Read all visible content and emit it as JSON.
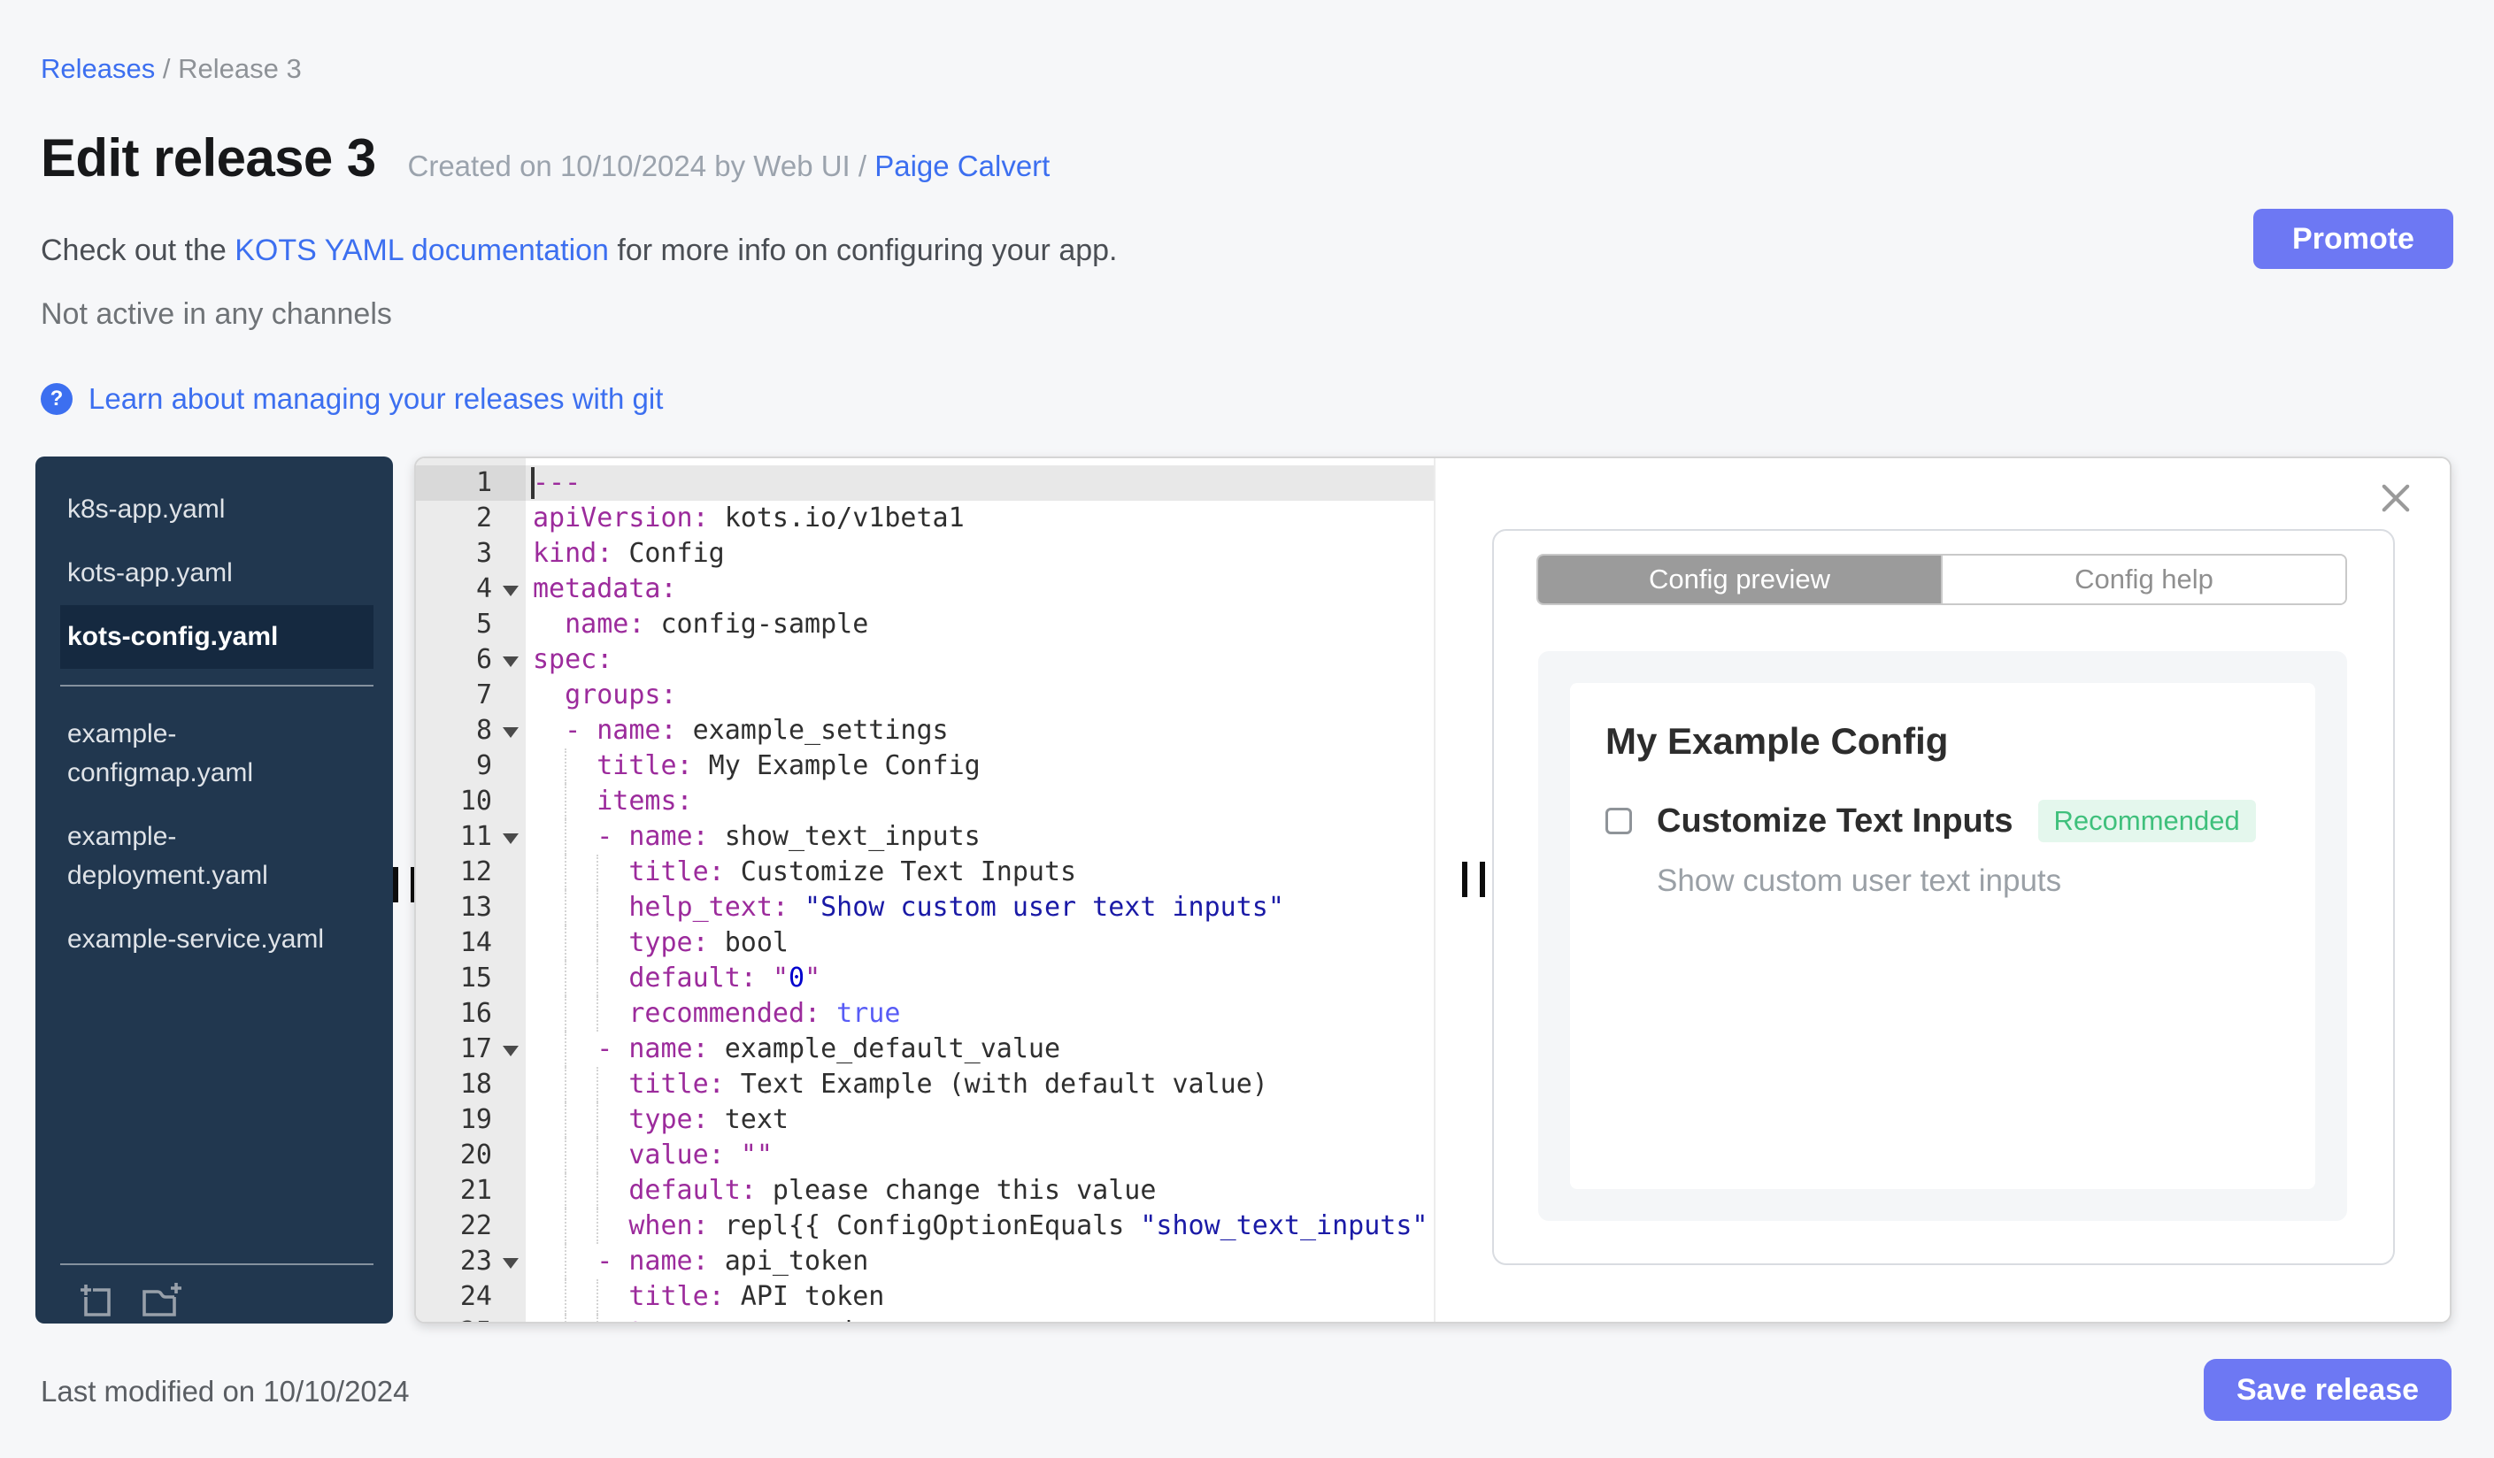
{
  "header": {
    "breadcrumb": {
      "link": "Releases",
      "separator": " / ",
      "current": "Release 3"
    },
    "title": "Edit release 3",
    "created_prefix": "Created on 10/10/2024 by Web UI / ",
    "created_author": "Paige Calvert",
    "docs_prefix": "Check out the ",
    "docs_link": "KOTS YAML documentation",
    "docs_suffix": " for more info on configuring your app.",
    "channel_status": "Not active in any channels",
    "git_help_link": "Learn about managing your releases with git",
    "promote_label": "Promote"
  },
  "sidebar": {
    "groups": [
      {
        "files": [
          {
            "name": "k8s-app.yaml",
            "selected": false
          },
          {
            "name": "kots-app.yaml",
            "selected": false
          },
          {
            "name": "kots-config.yaml",
            "selected": true
          }
        ]
      },
      {
        "files": [
          {
            "name": "example-configmap.yaml",
            "selected": false
          },
          {
            "name": "example-deployment.yaml",
            "selected": false
          },
          {
            "name": "example-service.yaml",
            "selected": false
          }
        ]
      }
    ],
    "icons": [
      "upload-file-icon",
      "new-file-icon"
    ]
  },
  "editor": {
    "active_line": 1,
    "fold_lines": [
      4,
      6,
      8,
      11,
      17,
      23
    ],
    "lines": [
      [
        {
          "t": "---",
          "c": "key"
        }
      ],
      [
        {
          "t": "apiVersion:",
          "c": "key"
        },
        {
          "t": " kots.io/v1beta1",
          "c": "txt"
        }
      ],
      [
        {
          "t": "kind:",
          "c": "key"
        },
        {
          "t": " Config",
          "c": "txt"
        }
      ],
      [
        {
          "t": "metadata:",
          "c": "key"
        }
      ],
      [
        {
          "t": "  name:",
          "c": "key"
        },
        {
          "t": " config-sample",
          "c": "txt"
        }
      ],
      [
        {
          "t": "spec:",
          "c": "key"
        }
      ],
      [
        {
          "t": "  groups:",
          "c": "key"
        }
      ],
      [
        {
          "t": "  - name:",
          "c": "key"
        },
        {
          "t": " example_settings",
          "c": "txt"
        }
      ],
      [
        {
          "t": "    title:",
          "c": "key"
        },
        {
          "t": " My Example Config",
          "c": "txt"
        }
      ],
      [
        {
          "t": "    items:",
          "c": "key"
        }
      ],
      [
        {
          "t": "    - name:",
          "c": "key"
        },
        {
          "t": " show_text_inputs",
          "c": "txt"
        }
      ],
      [
        {
          "t": "      title:",
          "c": "key"
        },
        {
          "t": " Customize Text Inputs",
          "c": "txt"
        }
      ],
      [
        {
          "t": "      help_text:",
          "c": "key"
        },
        {
          "t": " ",
          "c": "txt"
        },
        {
          "t": "\"Show custom user text inputs\"",
          "c": "str"
        }
      ],
      [
        {
          "t": "      type:",
          "c": "key"
        },
        {
          "t": " bool",
          "c": "txt"
        }
      ],
      [
        {
          "t": "      default:",
          "c": "key"
        },
        {
          "t": " ",
          "c": "txt"
        },
        {
          "t": "\"",
          "c": "key"
        },
        {
          "t": "0",
          "c": "num"
        },
        {
          "t": "\"",
          "c": "key"
        }
      ],
      [
        {
          "t": "      recommended:",
          "c": "key"
        },
        {
          "t": " ",
          "c": "txt"
        },
        {
          "t": "true",
          "c": "bool"
        }
      ],
      [
        {
          "t": "    - name:",
          "c": "key"
        },
        {
          "t": " example_default_value",
          "c": "txt"
        }
      ],
      [
        {
          "t": "      title:",
          "c": "key"
        },
        {
          "t": " Text Example (with default value)",
          "c": "txt"
        }
      ],
      [
        {
          "t": "      type:",
          "c": "key"
        },
        {
          "t": " text",
          "c": "txt"
        }
      ],
      [
        {
          "t": "      value:",
          "c": "key"
        },
        {
          "t": " ",
          "c": "txt"
        },
        {
          "t": "\"\"",
          "c": "key"
        }
      ],
      [
        {
          "t": "      default:",
          "c": "key"
        },
        {
          "t": " please change this value",
          "c": "txt"
        }
      ],
      [
        {
          "t": "      when:",
          "c": "key"
        },
        {
          "t": " repl{{ ConfigOptionEquals ",
          "c": "txt"
        },
        {
          "t": "\"show_text_inputs\"",
          "c": "str"
        }
      ],
      [
        {
          "t": "    - name:",
          "c": "key"
        },
        {
          "t": " api_token",
          "c": "txt"
        }
      ],
      [
        {
          "t": "      title:",
          "c": "key"
        },
        {
          "t": " API token",
          "c": "txt"
        }
      ],
      [
        {
          "t": "      type:",
          "c": "key"
        },
        {
          "t": " password",
          "c": "txt"
        }
      ]
    ]
  },
  "preview": {
    "tabs": [
      {
        "label": "Config preview",
        "active": true
      },
      {
        "label": "Config help",
        "active": false
      }
    ],
    "group_title": "My Example Config",
    "item_label": "Customize Text Inputs",
    "item_checked": false,
    "badge": "Recommended",
    "help_text": "Show custom user text inputs"
  },
  "footer": {
    "modified": "Last modified on 10/10/2024",
    "save_label": "Save release"
  },
  "colors": {
    "accent": "#6d78f3",
    "link": "#3c6ff0",
    "sidebar_bg": "#21374f",
    "sidebar_selected_bg": "#152940",
    "badge_text": "#3fc07c",
    "badge_bg": "#e4f7ed",
    "syntax": {
      "key": "#9c2b9c",
      "text": "#2f2f2f",
      "string": "#1a1aa6",
      "boolean": "#585cf6",
      "number": "#0000cd"
    }
  }
}
